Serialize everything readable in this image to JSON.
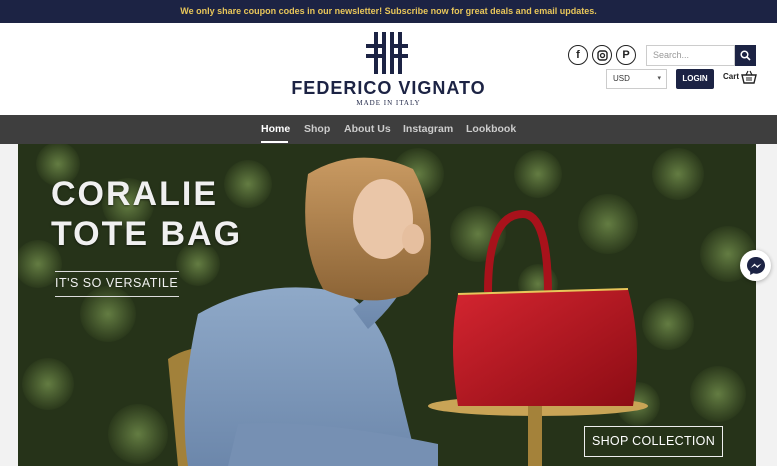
{
  "announcement": "We only share coupon codes in our newsletter! Subscribe now for great deals and email updates.",
  "brand": {
    "name": "FEDERICO VIGNATO",
    "tagline": "MADE IN ITALY"
  },
  "social": [
    {
      "icon": "facebook-icon",
      "glyph": "f"
    },
    {
      "icon": "instagram-icon",
      "glyph": ""
    },
    {
      "icon": "pinterest-icon",
      "glyph": "P"
    }
  ],
  "search": {
    "placeholder": "Search..."
  },
  "currency": {
    "selected": "USD"
  },
  "login_label": "LOGIN",
  "cart_label": "Cart",
  "nav": [
    {
      "label": "Home",
      "active": true
    },
    {
      "label": "Shop"
    },
    {
      "label": "About Us"
    },
    {
      "label": "Instagram"
    },
    {
      "label": "Lookbook"
    }
  ],
  "hero": {
    "title_line1": "CORALIE",
    "title_line2": "TOTE BAG",
    "subtitle": "IT'S SO VERSATILE",
    "cta": "SHOP COLLECTION"
  },
  "colors": {
    "navy": "#1c2344",
    "gold": "#e8c65a",
    "nav_bg": "#3e3e3e",
    "bag_red": "#b5121b"
  }
}
